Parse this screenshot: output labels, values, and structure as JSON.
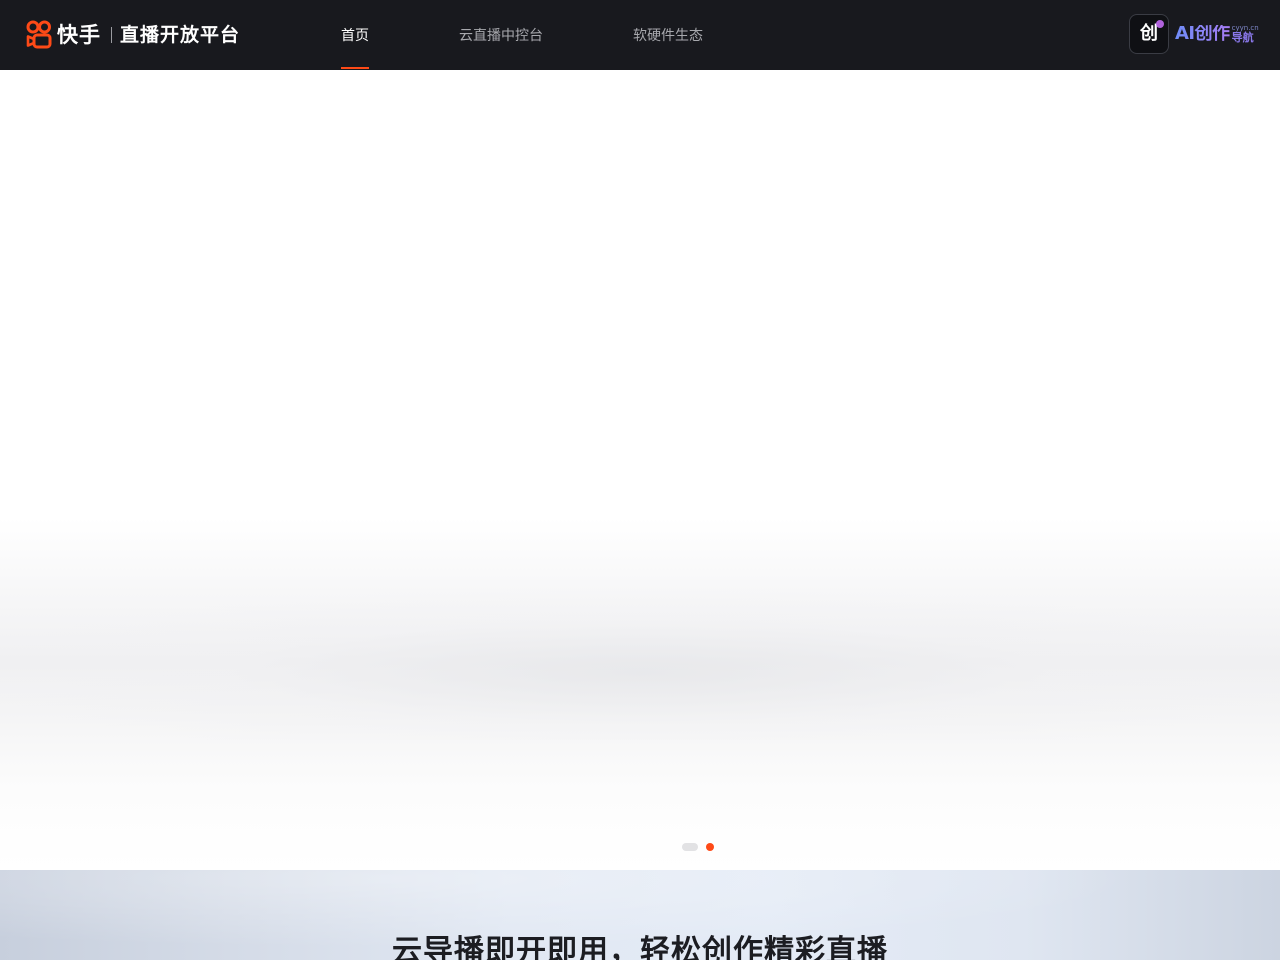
{
  "header": {
    "brand_name": "快手",
    "brand_subtitle": "直播开放平台",
    "brand_color": "#fe4a17",
    "background": "#18191e",
    "nav": [
      {
        "label": "首页",
        "active": true
      },
      {
        "label": "云直播中控台",
        "active": false
      },
      {
        "label": "软硬件生态",
        "active": false
      }
    ],
    "ai_badge": {
      "icon_glyph": "创",
      "title": "AI创作",
      "domain": "cyyn.cn",
      "subtitle": "导航"
    }
  },
  "hero": {
    "slide_count": 2,
    "active_slide": 2,
    "active_color": "#fe4a17"
  },
  "section2": {
    "title": "云导播即开即用，轻松创作精彩直播"
  }
}
